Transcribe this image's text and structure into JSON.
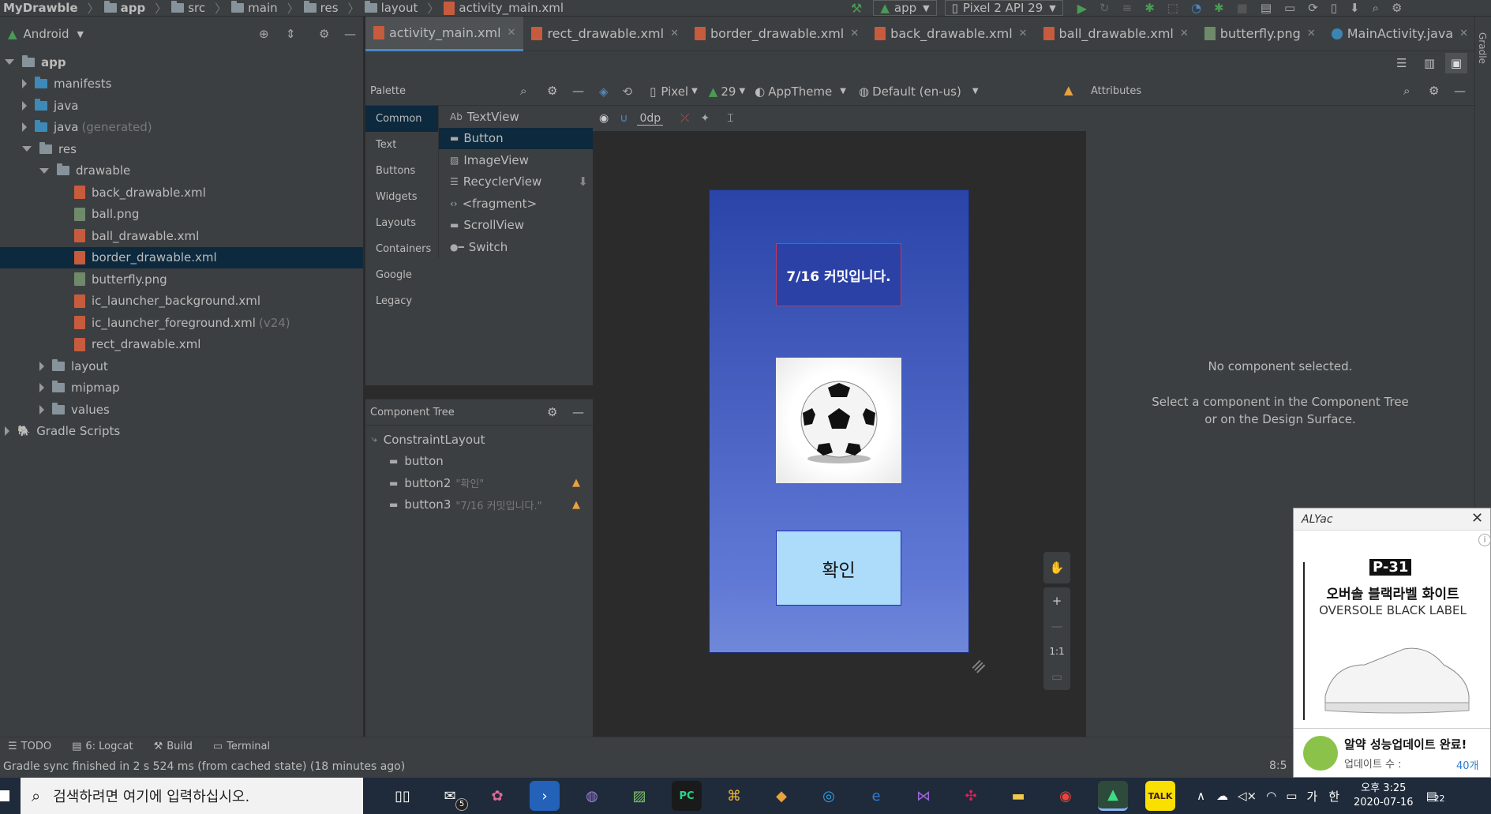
{
  "breadcrumb": [
    "MyDrawble",
    "app",
    "src",
    "main",
    "res",
    "layout",
    "activity_main.xml"
  ],
  "run_config": {
    "module": "app",
    "device": "Pixel 2 API 29"
  },
  "project_panel": {
    "view": "Android",
    "tree": [
      {
        "label": "app",
        "kind": "folder",
        "depth": 0,
        "open": true
      },
      {
        "label": "manifests",
        "kind": "folder-blue",
        "depth": 1,
        "open": false
      },
      {
        "label": "java",
        "kind": "folder-blue",
        "depth": 1,
        "open": false
      },
      {
        "label": "java",
        "suffix": "(generated)",
        "kind": "folder-blue",
        "depth": 1,
        "open": false
      },
      {
        "label": "res",
        "kind": "folder",
        "depth": 1,
        "open": true
      },
      {
        "label": "drawable",
        "kind": "folder",
        "depth": 2,
        "open": true
      },
      {
        "label": "back_drawable.xml",
        "kind": "xml",
        "depth": 3
      },
      {
        "label": "ball.png",
        "kind": "png",
        "depth": 3
      },
      {
        "label": "ball_drawable.xml",
        "kind": "xml",
        "depth": 3
      },
      {
        "label": "border_drawable.xml",
        "kind": "xml",
        "depth": 3,
        "selected": true
      },
      {
        "label": "butterfly.png",
        "kind": "png",
        "depth": 3
      },
      {
        "label": "ic_launcher_background.xml",
        "kind": "xml",
        "depth": 3
      },
      {
        "label": "ic_launcher_foreground.xml",
        "suffix": "(v24)",
        "kind": "xml",
        "depth": 3
      },
      {
        "label": "rect_drawable.xml",
        "kind": "xml",
        "depth": 3
      },
      {
        "label": "layout",
        "kind": "folder",
        "depth": 2,
        "open": false
      },
      {
        "label": "mipmap",
        "kind": "folder",
        "depth": 2,
        "open": false
      },
      {
        "label": "values",
        "kind": "folder",
        "depth": 2,
        "open": false
      },
      {
        "label": "Gradle Scripts",
        "kind": "gradle",
        "depth": 0,
        "open": false
      }
    ]
  },
  "editor_tabs": [
    {
      "label": "activity_main.xml",
      "kind": "xml",
      "active": true
    },
    {
      "label": "rect_drawable.xml",
      "kind": "xml"
    },
    {
      "label": "border_drawable.xml",
      "kind": "xml"
    },
    {
      "label": "back_drawable.xml",
      "kind": "xml"
    },
    {
      "label": "ball_drawable.xml",
      "kind": "xml"
    },
    {
      "label": "butterfly.png",
      "kind": "png"
    },
    {
      "label": "MainActivity.java",
      "kind": "java"
    }
  ],
  "palette": {
    "title": "Palette",
    "categories": [
      "Common",
      "Text",
      "Buttons",
      "Widgets",
      "Layouts",
      "Containers",
      "Google",
      "Legacy"
    ],
    "items": [
      {
        "label": "TextView",
        "icon": "Ab"
      },
      {
        "label": "Button",
        "icon": "button-icon",
        "active": true
      },
      {
        "label": "ImageView",
        "icon": "image-icon"
      },
      {
        "label": "RecyclerView",
        "icon": "list-icon"
      },
      {
        "label": "<fragment>",
        "icon": "code-icon"
      },
      {
        "label": "ScrollView",
        "icon": "scroll-icon"
      },
      {
        "label": "Switch",
        "icon": "switch-icon"
      }
    ]
  },
  "design_toolbar": {
    "device": "Pixel",
    "api": "29",
    "theme": "AppTheme",
    "locale": "Default (en-us)",
    "margin": "0dp"
  },
  "component_tree": {
    "title": "Component Tree",
    "items": [
      {
        "label": "ConstraintLayout",
        "depth": 0
      },
      {
        "label": "button",
        "depth": 1
      },
      {
        "label": "button2",
        "hint": "\"확인\"",
        "depth": 1,
        "warning": true
      },
      {
        "label": "button3",
        "hint": "\"7/16 커밋입니다.\"",
        "depth": 1,
        "warning": true
      }
    ]
  },
  "device_preview": {
    "text_button": "7/16 커밋입니다.",
    "confirm_button": "확인"
  },
  "zoom_controls": {
    "one_to_one": "1:1"
  },
  "attributes": {
    "title": "Attributes",
    "empty_title": "No component selected.",
    "empty_body": "Select a component in the Component Tree or on the Design Surface."
  },
  "right_strip": "Gradle",
  "bottom_tools": [
    {
      "label": "TODO"
    },
    {
      "label": "6: Logcat"
    },
    {
      "label": "Build"
    },
    {
      "label": "Terminal"
    }
  ],
  "status_bar": {
    "message": "Gradle sync finished in 2 s 524 ms (from cached state) (18 minutes ago)",
    "position": "8:5"
  },
  "popup": {
    "brand": "ALYac",
    "ad_tag": "P-31",
    "ad_title": "오버솔 블랙라벨 화이트",
    "ad_subtitle": "OVERSOLE BLACK LABEL",
    "footer_title": "알약 성능업데이트 완료!",
    "footer_label": "업데이트 수 :",
    "footer_count": "40개"
  },
  "taskbar": {
    "search_placeholder": "검색하려면 여기에 입력하십시오.",
    "mail_badge": "5",
    "time": "오후 3:25",
    "date": "2020-07-16",
    "ime": "가",
    "lang": "한",
    "notifications": "22"
  },
  "colors": {
    "accent": "#4a88c7",
    "selection": "#0d293e",
    "warning": "#e8a33d",
    "run": "#499c54"
  }
}
